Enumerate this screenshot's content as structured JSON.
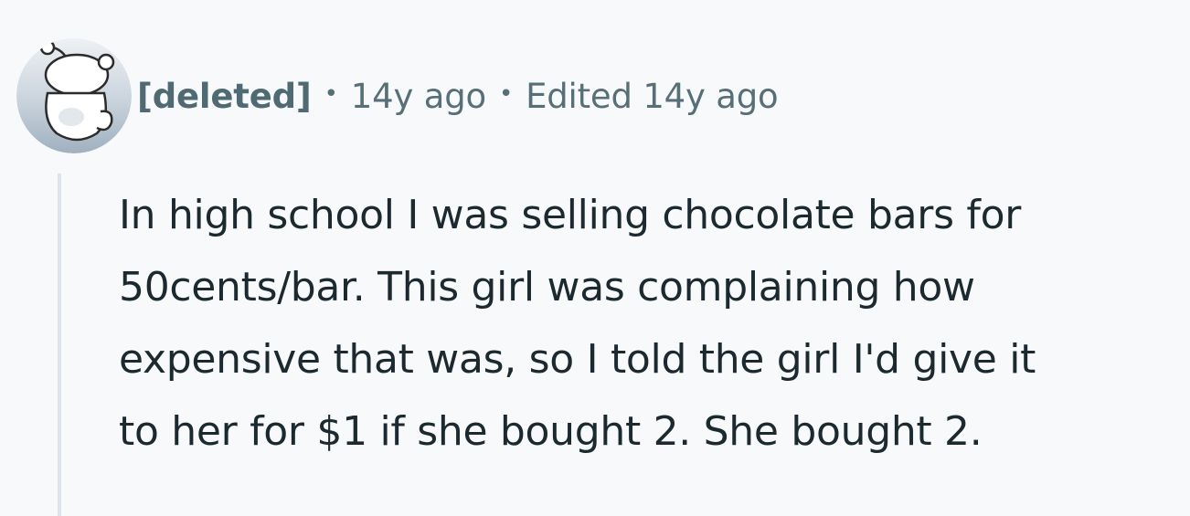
{
  "comment": {
    "author": "[deleted]",
    "separator": "•",
    "timestamp": "14y ago",
    "edited": "Edited 14y ago",
    "body_lines": [
      "In high school I was selling chocolate bars for",
      "50cents/bar. This girl was complaining how",
      "expensive that was, so I told the girl I'd give it",
      "to her for $1 if she bought 2. She bought 2."
    ],
    "avatar_icon": "snoo-avatar-icon"
  },
  "colors": {
    "background": "#f7f9fb",
    "meta_text": "#576f76",
    "author_text": "#4f6a73",
    "body_text": "#1c2a30",
    "thread_line": "#dde3e8"
  }
}
